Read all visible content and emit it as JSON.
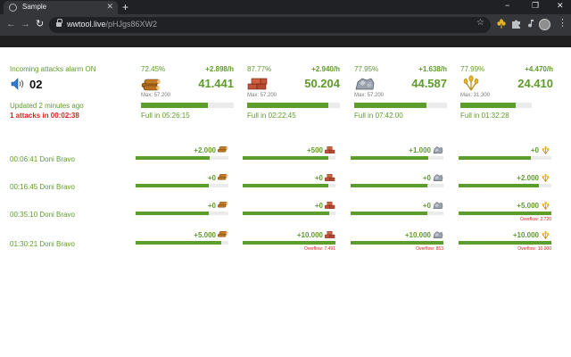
{
  "browser": {
    "tab_title": "Sample",
    "tab_close": "✕",
    "new_tab": "+",
    "url_host": "wwtool.live",
    "url_path": "/pHJgs86XW2",
    "star": "☆",
    "back": "←",
    "forward": "→",
    "reload": "↻",
    "minimize": "−",
    "maximize": "❐",
    "close": "✕",
    "menu": "⋮"
  },
  "status": {
    "alarm_text": "Incoming attacks alarm ON",
    "wave_count": "02",
    "updated_text": "Updated 2 minutes ago",
    "next_attack_text": "1 attacks in 00:02:38"
  },
  "resources": [
    {
      "name": "wood",
      "percent": "72.45%",
      "rate": "+2.898/h",
      "amount": "41.441",
      "max": "Max: 57.200",
      "full_in": "Full in 05:26:15",
      "fill": 0.7245,
      "icon": "wood-icon"
    },
    {
      "name": "clay",
      "percent": "87.77%",
      "rate": "+2.940/h",
      "amount": "50.204",
      "max": "Max: 57.200",
      "full_in": "Full in 02:22:45",
      "fill": 0.8777,
      "icon": "clay-icon"
    },
    {
      "name": "iron",
      "percent": "77.95%",
      "rate": "+1.638/h",
      "amount": "44.587",
      "max": "Max: 57.200",
      "full_in": "Full in 07:42:00",
      "fill": 0.7795,
      "icon": "iron-icon"
    },
    {
      "name": "crop",
      "percent": "77.99%",
      "rate": "+4.470/h",
      "amount": "24.410",
      "max": "Max: 31.300",
      "full_in": "Full in 01:32:28",
      "fill": 0.7799,
      "icon": "crop-icon"
    }
  ],
  "attacks": [
    {
      "label": "00:06:41 Doni Bravo",
      "cells": [
        {
          "value": "+2.000",
          "fill": 0.8,
          "overflow": ""
        },
        {
          "value": "+500",
          "fill": 0.92,
          "overflow": ""
        },
        {
          "value": "+1.000",
          "fill": 0.84,
          "overflow": ""
        },
        {
          "value": "+0",
          "fill": 0.78,
          "overflow": ""
        }
      ]
    },
    {
      "label": "00:16:45 Doni Bravo",
      "cells": [
        {
          "value": "+0",
          "fill": 0.79,
          "overflow": ""
        },
        {
          "value": "+0",
          "fill": 0.92,
          "overflow": ""
        },
        {
          "value": "+0",
          "fill": 0.83,
          "overflow": ""
        },
        {
          "value": "+2.000",
          "fill": 0.87,
          "overflow": ""
        }
      ]
    },
    {
      "label": "00:35:10 Doni Bravo",
      "cells": [
        {
          "value": "+0",
          "fill": 0.79,
          "overflow": ""
        },
        {
          "value": "+0",
          "fill": 0.93,
          "overflow": ""
        },
        {
          "value": "+0",
          "fill": 0.83,
          "overflow": ""
        },
        {
          "value": "+5.000",
          "fill": 1.0,
          "overflow": "Overflow: 2.720"
        }
      ]
    },
    {
      "label": "01:30:21 Doni Bravo",
      "cells": [
        {
          "value": "+5.000",
          "fill": 0.92,
          "overflow": ""
        },
        {
          "value": "+10.000",
          "fill": 1.0,
          "overflow": "Overflow: 7.491"
        },
        {
          "value": "+10.000",
          "fill": 1.0,
          "overflow": "Overflow: 853"
        },
        {
          "value": "+10.000",
          "fill": 1.0,
          "overflow": "Overflow: 10.000"
        }
      ]
    }
  ],
  "colors": {
    "accent_green": "#5f9a2e",
    "bar_green": "#5c9d2c",
    "alert_red": "#e02020",
    "chrome_dark": "#202124"
  }
}
